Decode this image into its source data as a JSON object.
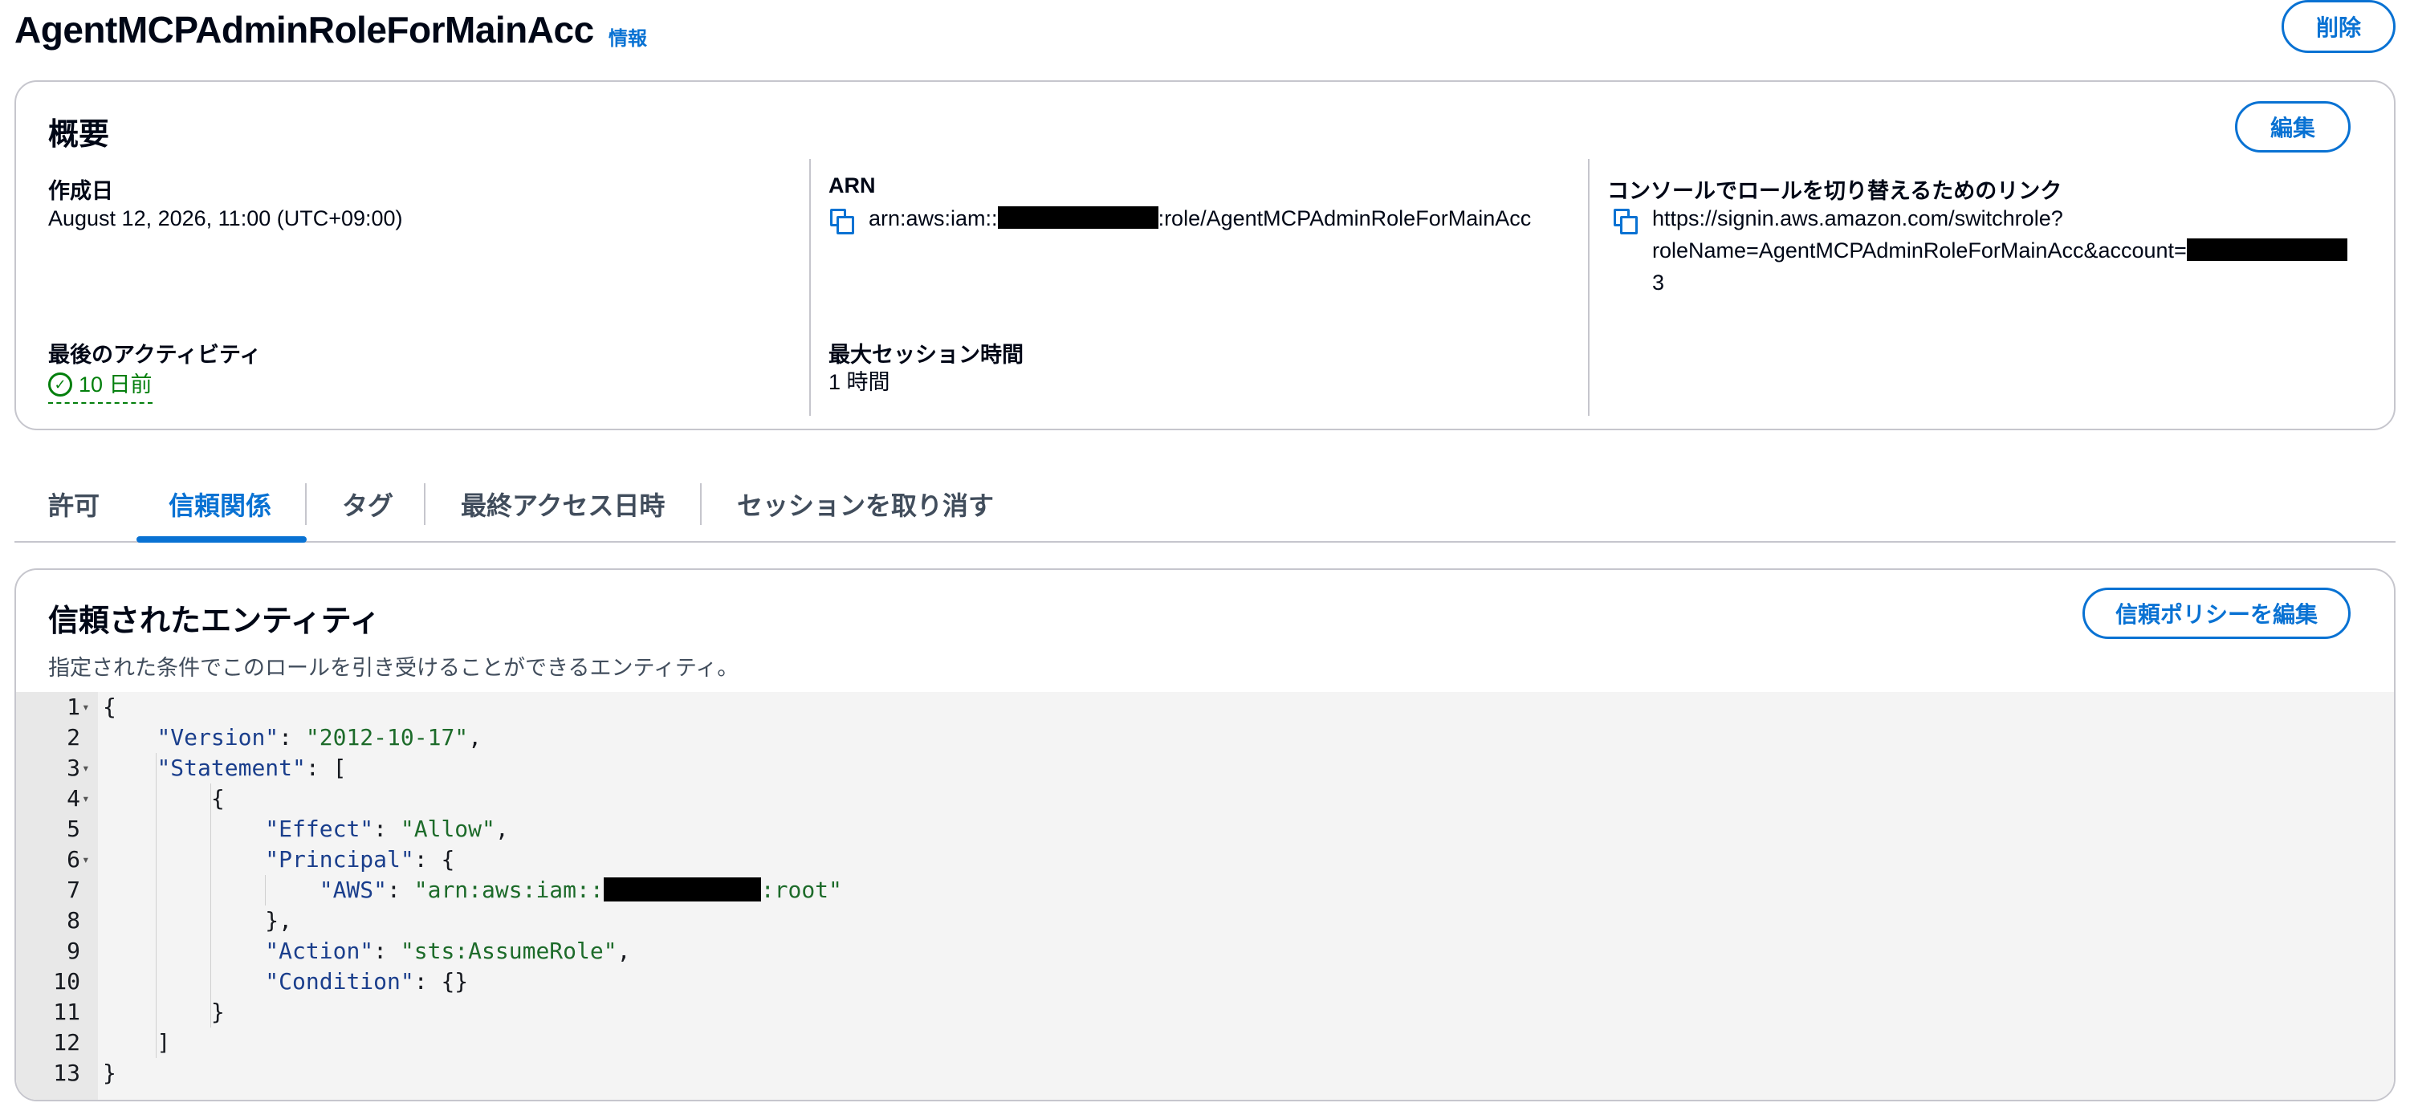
{
  "header": {
    "title": "AgentMCPAdminRoleForMainAcc",
    "info_label": "情報",
    "delete_label": "削除"
  },
  "overview": {
    "title": "概要",
    "edit_label": "編集",
    "created": {
      "label": "作成日",
      "value": "August 12, 2026, 11:00 (UTC+09:00)"
    },
    "arn": {
      "label": "ARN",
      "prefix": "arn:aws:iam::",
      "suffix": ":role/AgentMCPAdminRoleForMainAcc"
    },
    "switch_link": {
      "label": "コンソールでロールを切り替えるためのリンク",
      "line1": "https://signin.aws.amazon.com/switchrole?",
      "line2": "roleName=AgentMCPAdminRoleForMainAcc&account=",
      "line3": "3"
    },
    "last_activity": {
      "label": "最後のアクティビティ",
      "value": "10 日前"
    },
    "max_session": {
      "label": "最大セッション時間",
      "value": "1 時間"
    }
  },
  "tabs": [
    {
      "label": "許可"
    },
    {
      "label": "信頼関係"
    },
    {
      "label": "タグ"
    },
    {
      "label": "最終アクセス日時"
    },
    {
      "label": "セッションを取り消す"
    }
  ],
  "active_tab": "信頼関係",
  "trusted": {
    "title": "信頼されたエンティティ",
    "description": "指定された条件でこのロールを引き受けることができるエンティティ。",
    "edit_policy_label": "信頼ポリシーを編集"
  },
  "policy": {
    "line_numbers": [
      "1",
      "2",
      "3",
      "4",
      "5",
      "6",
      "7",
      "8",
      "9",
      "10",
      "11",
      "12",
      "13"
    ],
    "version_key": "\"Version\"",
    "version_value": "\"2012-10-17\"",
    "statement_key": "\"Statement\"",
    "effect_key": "\"Effect\"",
    "effect_value": "\"Allow\"",
    "principal_key": "\"Principal\"",
    "aws_key": "\"AWS\"",
    "aws_value_prefix": "\"arn:aws:iam::",
    "aws_value_suffix": ":root\"",
    "action_key": "\"Action\"",
    "action_value": "\"sts:AssumeRole\"",
    "condition_key": "\"Condition\""
  },
  "colors": {
    "accent": "#0972d3",
    "success": "#037f0c",
    "border": "#c6c6cd"
  }
}
